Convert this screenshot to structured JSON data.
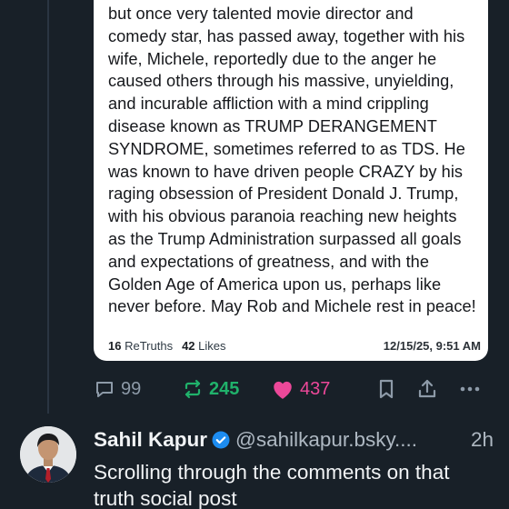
{
  "embed": {
    "body": "but once very talented movie director and\ncomedy star, has passed away, together with his\nwife, Michele, reportedly due to the anger he\ncaused others through his massive, unyielding,\nand incurable affliction with a mind crippling\ndisease known as TRUMP DERANGEMENT\nSYNDROME, sometimes referred to as TDS. He\nwas known to have driven people CRAZY by his\nraging obsession of President Donald J. Trump,\nwith his obvious paranoia reaching new heights\nas the Trump Administration surpassed all goals\nand expectations of greatness, and with the\nGolden Age of America upon us, perhaps like\nnever before. May Rob and Michele rest in peace!",
    "retruths_count": "16",
    "retruths_label": "ReTruths",
    "likes_count": "42",
    "likes_label": "Likes",
    "date": "12/15/25, 9:51 AM"
  },
  "actions": {
    "replies": "99",
    "reposts": "245",
    "likes": "437",
    "icons": [
      "reply-icon",
      "repost-icon",
      "heart-icon",
      "bookmark-icon",
      "share-icon",
      "more-icon"
    ]
  },
  "post": {
    "author": "Sahil Kapur",
    "handle": "@sahilkapur.bsky....",
    "time": "2h",
    "text": "Scrolling through the comments on that truth social post"
  },
  "colors": {
    "background": "#182028",
    "repost": "#20b26b",
    "like": "#ec4899",
    "verified": "#1d8cf0"
  }
}
